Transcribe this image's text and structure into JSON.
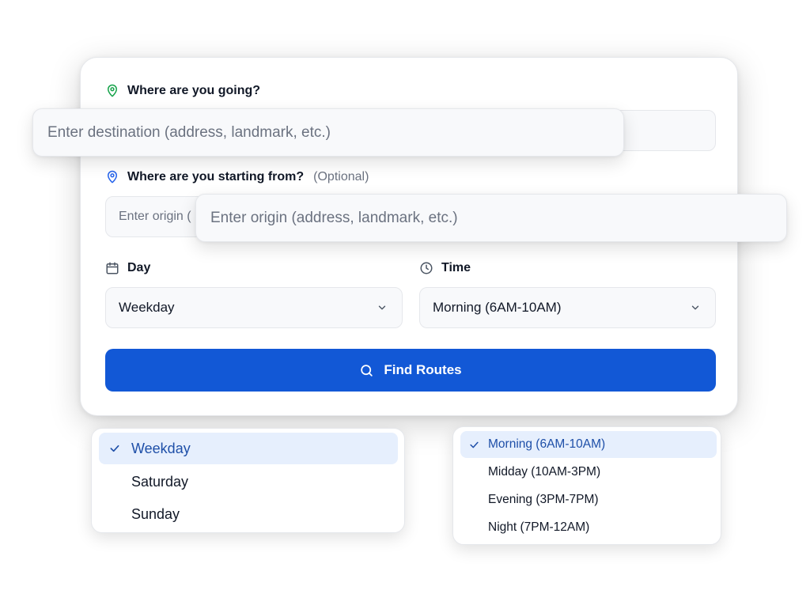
{
  "destination": {
    "label": "Where are you going?",
    "placeholder": "Enter destination (address, landmark, etc.)"
  },
  "origin": {
    "label": "Where are you starting from?",
    "optional": "(Optional)",
    "placeholder_truncated": "Enter origin (",
    "placeholder": "Enter origin (address, landmark, etc.)"
  },
  "day": {
    "label": "Day",
    "selected": "Weekday",
    "options": [
      "Weekday",
      "Saturday",
      "Sunday"
    ]
  },
  "time": {
    "label": "Time",
    "selected": "Morning (6AM-10AM)",
    "options": [
      "Morning (6AM-10AM)",
      "Midday (10AM-3PM)",
      "Evening (3PM-7PM)",
      "Night (7PM-12AM)"
    ]
  },
  "button": {
    "label": "Find Routes"
  },
  "icons": {
    "destination": "map-pin-icon",
    "origin": "map-pin-icon",
    "day": "calendar-icon",
    "time": "clock-icon",
    "button": "search-icon",
    "select": "chevron-down-icon",
    "selected_option": "check-icon"
  },
  "colors": {
    "primary": "#1258d6",
    "destination_pin": "#16a34a",
    "origin_pin": "#2563eb",
    "selected_bg": "#e6effd"
  }
}
